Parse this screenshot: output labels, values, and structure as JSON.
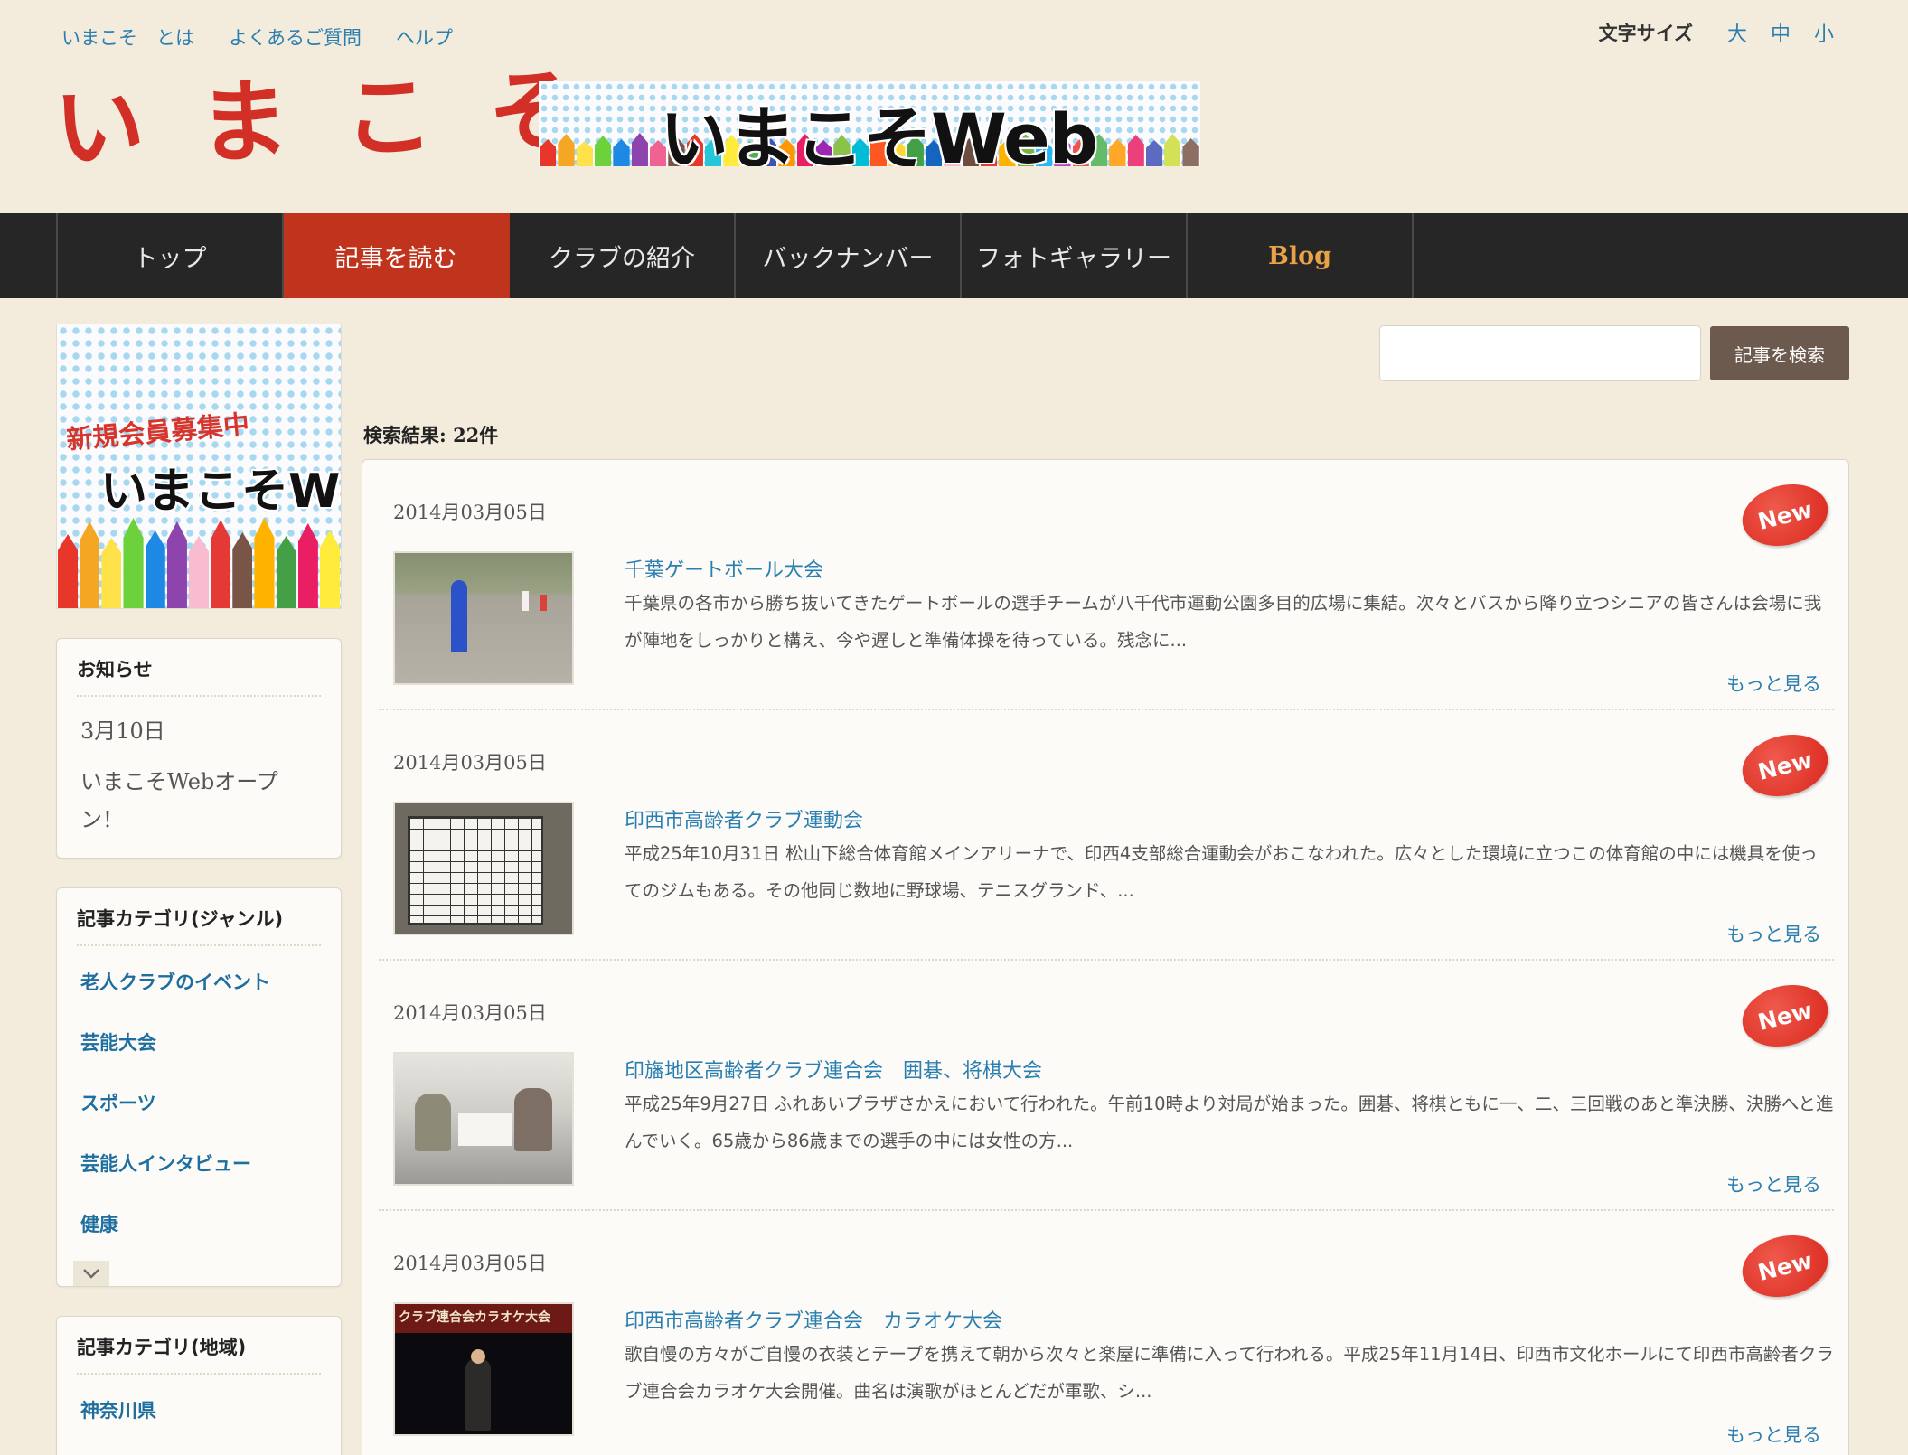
{
  "header": {
    "top_links": [
      "いまこそ　とは",
      "よくあるご質問",
      "ヘルプ"
    ],
    "font_size_label": "文字サイズ",
    "font_size_options": [
      "大",
      "中",
      "小"
    ],
    "logo_text": "いまこそ",
    "banner_text": "いまこそWeb"
  },
  "nav": {
    "items": [
      "トップ",
      "記事を読む",
      "クラブの紹介",
      "バックナンバー",
      "フォトギャラリー",
      "Blog"
    ],
    "active_index": 1
  },
  "sidebar": {
    "banner": {
      "recruit_text": "新規会員募集中",
      "web_text": "いまこそWeb"
    },
    "news": {
      "title": "お知らせ",
      "date": "3月10日",
      "text": "いまこそWebオープン！"
    },
    "categories_genre": {
      "title": "記事カテゴリ(ジャンル)",
      "items": [
        "老人クラブのイベント",
        "芸能大会",
        "スポーツ",
        "芸能人インタビュー",
        "健康"
      ]
    },
    "categories_region": {
      "title": "記事カテゴリ(地域)",
      "items": [
        "神奈川県"
      ]
    }
  },
  "search": {
    "input_value": "",
    "button_label": "記事を検索",
    "result_count": "検索結果: 22件"
  },
  "articles": [
    {
      "date": "2014月03月05日",
      "title": "千葉ゲートボール大会",
      "excerpt": "千葉県の各市から勝ち抜いてきたゲートボールの選手チームが八千代市運動公園多目的広場に集結。次々とバスから降り立つシニアの皆さんは会場に我が陣地をしっかりと構え、今や遅しと準備体操を待っている。残念に...",
      "more": "もっと見る",
      "badge": "New"
    },
    {
      "date": "2014月03月05日",
      "title": "印西市高齢者クラブ運動会",
      "excerpt": "平成25年10月31日 松山下総合体育館メインアリーナで、印西4支部総合運動会がおこなわれた。広々とした環境に立つこの体育館の中には機具を使ってのジムもある。その他同じ数地に野球場、テニスグランド、...",
      "more": "もっと見る",
      "badge": "New"
    },
    {
      "date": "2014月03月05日",
      "title": "印旛地区高齢者クラブ連合会　囲碁、将棋大会",
      "excerpt": "平成25年9月27日 ふれあいプラザさかえにおいて行われた。午前10時より対局が始まった。囲碁、将棋ともに一、二、三回戦のあと準決勝、決勝へと進んでいく。65歳から86歳までの選手の中には女性の方...",
      "more": "もっと見る",
      "badge": "New"
    },
    {
      "date": "2014月03月05日",
      "title": "印西市高齢者クラブ連合会　カラオケ大会",
      "excerpt": "歌自慢の方々がご自慢の衣装とテープを携えて朝から次々と楽屋に準備に入って行われる。平成25年11月14日、印西市文化ホールにて印西市高齢者クラブ連合会カラオケ大会開催。曲名は演歌がほとんどだが軍歌、シ...",
      "more": "もっと見る",
      "badge": "New",
      "thumb_text": "クラブ連合会カラオケ大会"
    }
  ],
  "colors": {
    "link": "#2a7fb0",
    "nav_bg": "#262626",
    "nav_active": "#c0341d",
    "blog": "#e9a248",
    "badge": "#d9261c",
    "logo": "#d23026",
    "search_button": "#6c5a4e"
  }
}
